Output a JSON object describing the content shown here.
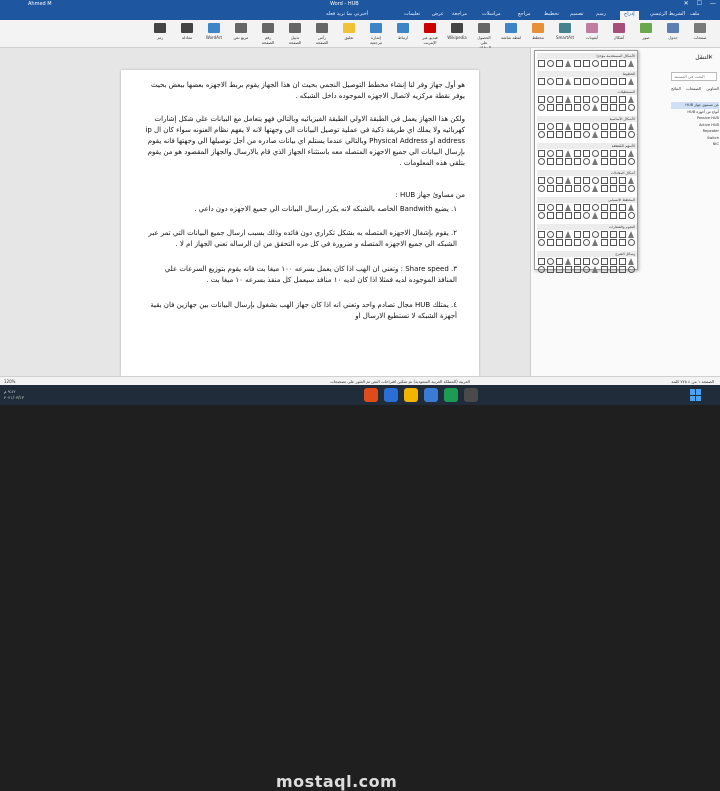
{
  "window": {
    "title": "Word - HUB",
    "account": "Ahmed M",
    "controls": [
      "—",
      "☐",
      "✕"
    ]
  },
  "tabs": [
    {
      "label": "ملف"
    },
    {
      "label": "الشريط الرئيسي"
    },
    {
      "label": "إدراج"
    },
    {
      "label": "رسم"
    },
    {
      "label": "تصميم"
    },
    {
      "label": "تخطيط"
    },
    {
      "label": "مراجع"
    },
    {
      "label": "مراسلات"
    },
    {
      "label": "مراجعة"
    },
    {
      "label": "عرض"
    },
    {
      "label": "تعليمات"
    },
    {
      "label": "أخبرني بما تريد فعله"
    }
  ],
  "ribbon_buttons": [
    {
      "label": "صفحات",
      "color": "#7a7a7a"
    },
    {
      "label": "جدول",
      "color": "#5b7fb5"
    },
    {
      "label": "صور",
      "color": "#6aa84f"
    },
    {
      "label": "أشكال",
      "color": "#a64d79"
    },
    {
      "label": "أيقونات",
      "color": "#c27ba0"
    },
    {
      "label": "SmartArt",
      "color": "#45818e"
    },
    {
      "label": "مخطط",
      "color": "#e69138"
    },
    {
      "label": "لقطة شاشة",
      "color": "#3d85c6"
    },
    {
      "label": "الحصول على الوظائف الإضافية",
      "color": "#666"
    },
    {
      "label": "Wikipedia",
      "color": "#444"
    },
    {
      "label": "فيديو عبر الإنترنت",
      "color": "#cc0000"
    },
    {
      "label": "ارتباط",
      "color": "#3d85c6"
    },
    {
      "label": "إشارة مرجعية",
      "color": "#3d85c6"
    },
    {
      "label": "تعليق",
      "color": "#f1c232"
    },
    {
      "label": "رأس الصفحة",
      "color": "#666"
    },
    {
      "label": "تذييل الصفحة",
      "color": "#666"
    },
    {
      "label": "رقم الصفحة",
      "color": "#666"
    },
    {
      "label": "مربع نص",
      "color": "#666"
    },
    {
      "label": "WordArt",
      "color": "#3d85c6"
    },
    {
      "label": "معادلة",
      "color": "#444"
    },
    {
      "label": "رمز",
      "color": "#444"
    }
  ],
  "navigation_pane": {
    "title": "التنقل",
    "search_placeholder": "البحث في المستند",
    "tabs": [
      "العناوين",
      "الصفحات",
      "النتائج"
    ],
    "headings": [
      "عن مستوى جهاز HUB",
      "أنواع من أجهزة HUB",
      "Passive HUB",
      "Active HUB",
      "Repeater",
      "Switch",
      "NIC"
    ]
  },
  "shapes_gallery": {
    "sections": [
      "الأشكال المستخدمة مؤخرًا",
      "الخطوط",
      "المستطيلات",
      "الأشكال الأساسية",
      "الأسهم المُقطعة",
      "أشكال المعادلات",
      "المخطط الانسيابي",
      "النجوم والشعارات",
      "وسائل الشرح"
    ]
  },
  "document": {
    "paragraphs": [
      "هو أول جهاز وفر لنا إنشاء مخطط التوصيل النجمي بحيث ان هذا الجهاز يقوم بربط الاجهزه بعضها ببعض بحيث يوفر نقطة مركزيه لاتصال الاجهزه الموجوده داخل الشبكه .",
      "ولكن هذا الجهاز يعمل في الطبقة الاولي الطبقة الفيزيائيه وبالتالي فهو يتعامل مع البيانات علي شكل إشارات كهربائيه ولا يملك اي طريقة ذكية في عملية توصيل البيانات الي وجهتها لانه لا يفهم نظام العنونه سواء كان ال ip address او Physical Address وبالتالي عندما يستلم اي بيانات صادره من أجل توصيلها الي وجهتها فانه يقوم بإرسال البيانات الي جميع الاجهزه المتصله معه باستثناء الجهاز الذي قام بالارسال والجهاز المقصود هو من يقوم بتلقي هذه المعلومات .",
      "من مساوئ جهاز HUB :",
      "١. يضيع Bandwith الخاصه بالشبكه لانه يكرر ارسال البيانات الي جميع الاجهزه دون داعي .",
      "٢. يقوم بإشغال الاجهزه المتصله به بشكل تكراري دون فائده وذلك بسبب ارسال جميع البيانات التي تمر عبر الشبكه الي جميع الاجهزه المتصله و ضرورة في كل مره التحقق من ان الرساله تعني الجهاز ام لا .",
      "٣. Share speed : وتعني ان الهب اذا كان يعمل بسرعه ١٠٠ ميغا بت فانه يقوم بتوزيع السرعات علي المنافذ الموجوده لديه فمثلا اذا كان لديه ١٠ منافذ سيعمل كل منفذ بسرعه ١٠ ميغا بت .",
      "٤. يمتلك HUB مجال تصادم واحد وتعني انه اذا كان جهاز الهب بشغول بإرسال البيانات بين جهازين فان بقية أجهزة الشبكه لا تستطيع الارسال او"
    ]
  },
  "statusbar": {
    "left": "120%",
    "middle": "العربية (المملكة العربية السعودية)   تم تمكين اقتراحات النص   تم العثور على تصحيحات",
    "right": "الصفحة ١ من ٤   ٧٧٥ كلمة"
  },
  "taskbar": {
    "time": "٩:٤٢ م",
    "date": "٢٠٢١/٠٣/١٣"
  },
  "watermark": "mostaql.com"
}
